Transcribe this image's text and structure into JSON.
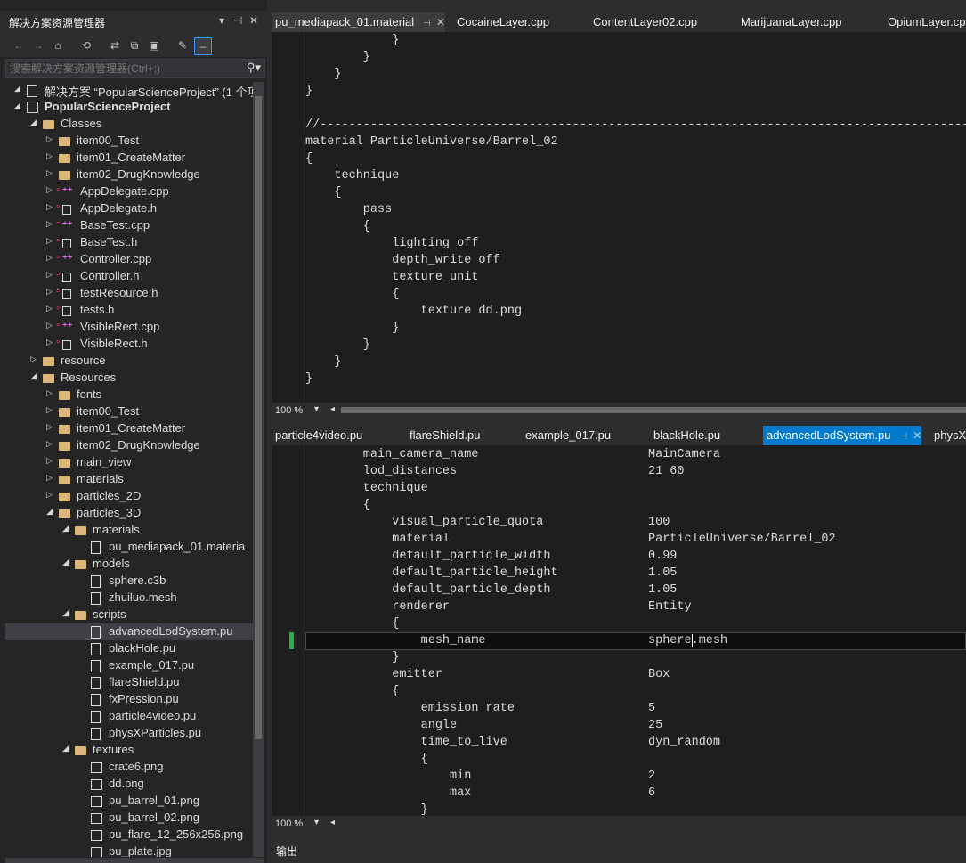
{
  "solution_explorer": {
    "title": "解决方案资源管理器",
    "pin_symbol": "⊿ ꟷ ✕",
    "search_placeholder": "搜索解决方案资源管理器(Ctrl+;)",
    "tree": [
      {
        "label": "解决方案 “PopularScienceProject” (1 个项",
        "depth": 0,
        "icon": "solution-icon",
        "expanded": true
      },
      {
        "label": "PopularScienceProject",
        "depth": 0,
        "icon": "project-icon",
        "expanded": true,
        "bold": true
      },
      {
        "label": "Classes",
        "depth": 1,
        "icon": "folder-icon",
        "expanded": true
      },
      {
        "label": "item00_Test",
        "depth": 2,
        "icon": "folder-icon",
        "expanded": false
      },
      {
        "label": "item01_CreateMatter",
        "depth": 2,
        "icon": "folder-icon",
        "expanded": false
      },
      {
        "label": "item02_DrugKnowledge",
        "depth": 2,
        "icon": "folder-icon",
        "expanded": false
      },
      {
        "label": "AppDelegate.cpp",
        "depth": 2,
        "icon": "cpp-file-icon",
        "expanded": false
      },
      {
        "label": "AppDelegate.h",
        "depth": 2,
        "icon": "header-file-icon",
        "expanded": false
      },
      {
        "label": "BaseTest.cpp",
        "depth": 2,
        "icon": "cpp-file-icon",
        "expanded": false
      },
      {
        "label": "BaseTest.h",
        "depth": 2,
        "icon": "header-file-icon",
        "expanded": false
      },
      {
        "label": "Controller.cpp",
        "depth": 2,
        "icon": "cpp-file-icon",
        "expanded": false
      },
      {
        "label": "Controller.h",
        "depth": 2,
        "icon": "header-file-icon",
        "expanded": false
      },
      {
        "label": "testResource.h",
        "depth": 2,
        "icon": "header-file-icon",
        "expanded": false
      },
      {
        "label": "tests.h",
        "depth": 2,
        "icon": "header-file-icon",
        "expanded": false
      },
      {
        "label": "VisibleRect.cpp",
        "depth": 2,
        "icon": "cpp-file-icon",
        "expanded": false
      },
      {
        "label": "VisibleRect.h",
        "depth": 2,
        "icon": "header-file-icon",
        "expanded": false
      },
      {
        "label": "resource",
        "depth": 1,
        "icon": "folder-icon",
        "expanded": false
      },
      {
        "label": "Resources",
        "depth": 1,
        "icon": "folder-icon",
        "expanded": true
      },
      {
        "label": "fonts",
        "depth": 2,
        "icon": "folder-icon",
        "expanded": false
      },
      {
        "label": "item00_Test",
        "depth": 2,
        "icon": "folder-icon",
        "expanded": false
      },
      {
        "label": "item01_CreateMatter",
        "depth": 2,
        "icon": "folder-icon",
        "expanded": false
      },
      {
        "label": "item02_DrugKnowledge",
        "depth": 2,
        "icon": "folder-icon",
        "expanded": false
      },
      {
        "label": "main_view",
        "depth": 2,
        "icon": "folder-icon",
        "expanded": false
      },
      {
        "label": "materials",
        "depth": 2,
        "icon": "folder-icon",
        "expanded": false
      },
      {
        "label": "particles_2D",
        "depth": 2,
        "icon": "folder-icon",
        "expanded": false
      },
      {
        "label": "particles_3D",
        "depth": 2,
        "icon": "folder-icon",
        "expanded": true
      },
      {
        "label": "materials",
        "depth": 3,
        "icon": "folder-icon",
        "expanded": true
      },
      {
        "label": "pu_mediapack_01.materia",
        "depth": 4,
        "icon": "file-icon",
        "leaf": true
      },
      {
        "label": "models",
        "depth": 3,
        "icon": "folder-icon",
        "expanded": true
      },
      {
        "label": "sphere.c3b",
        "depth": 4,
        "icon": "file-icon",
        "leaf": true
      },
      {
        "label": "zhuiluo.mesh",
        "depth": 4,
        "icon": "file-icon",
        "leaf": true
      },
      {
        "label": "scripts",
        "depth": 3,
        "icon": "folder-icon",
        "expanded": true
      },
      {
        "label": "advancedLodSystem.pu",
        "depth": 4,
        "icon": "file-icon",
        "leaf": true,
        "selected": true
      },
      {
        "label": "blackHole.pu",
        "depth": 4,
        "icon": "file-icon",
        "leaf": true
      },
      {
        "label": "example_017.pu",
        "depth": 4,
        "icon": "file-icon",
        "leaf": true
      },
      {
        "label": "flareShield.pu",
        "depth": 4,
        "icon": "file-icon",
        "leaf": true
      },
      {
        "label": "fxPression.pu",
        "depth": 4,
        "icon": "file-icon",
        "leaf": true
      },
      {
        "label": "particle4video.pu",
        "depth": 4,
        "icon": "file-icon",
        "leaf": true
      },
      {
        "label": "physXParticles.pu",
        "depth": 4,
        "icon": "file-icon",
        "leaf": true
      },
      {
        "label": "textures",
        "depth": 3,
        "icon": "folder-icon",
        "expanded": true
      },
      {
        "label": "crate6.png",
        "depth": 4,
        "icon": "image-file-icon",
        "leaf": true
      },
      {
        "label": "dd.png",
        "depth": 4,
        "icon": "image-file-icon",
        "leaf": true
      },
      {
        "label": "pu_barrel_01.png",
        "depth": 4,
        "icon": "image-file-icon",
        "leaf": true
      },
      {
        "label": "pu_barrel_02.png",
        "depth": 4,
        "icon": "image-file-icon",
        "leaf": true
      },
      {
        "label": "pu_flare_12_256x256.png",
        "depth": 4,
        "icon": "image-file-icon",
        "leaf": true
      },
      {
        "label": "pu_plate.jpg",
        "depth": 4,
        "icon": "image-file-icon",
        "leaf": true
      }
    ]
  },
  "editor_top": {
    "tabs": [
      {
        "label": "pu_mediapack_01.material",
        "active": true
      },
      {
        "label": "CocaineLayer.cpp"
      },
      {
        "label": "ContentLayer02.cpp"
      },
      {
        "label": "MarijuanaLayer.cpp"
      },
      {
        "label": "OpiumLayer.cpp"
      }
    ],
    "lines": [
      "            }",
      "        }",
      "    }",
      "}",
      "",
      "//------------------------------------------------------------------------------------------------------------",
      "material ParticleUniverse/Barrel_02",
      "{",
      "    technique",
      "    {",
      "        pass",
      "        {",
      "            lighting off",
      "            depth_write off",
      "            texture_unit",
      "            {",
      "                texture dd.png",
      "            }",
      "        }",
      "    }",
      "}"
    ],
    "zoom": "100 %"
  },
  "editor_bottom": {
    "tabs": [
      {
        "label": "particle4video.pu"
      },
      {
        "label": "flareShield.pu"
      },
      {
        "label": "example_017.pu"
      },
      {
        "label": "blackHole.pu"
      },
      {
        "label": "advancedLodSystem.pu",
        "active": true
      },
      {
        "label": "physX"
      }
    ],
    "lines": [
      {
        "key": "        main_camera_name",
        "value": "MainCamera"
      },
      {
        "key": "        lod_distances",
        "value": "21 60"
      },
      {
        "key": "        technique",
        "value": ""
      },
      {
        "key": "        {",
        "value": ""
      },
      {
        "key": "            visual_particle_quota",
        "value": "100"
      },
      {
        "key": "            material",
        "value": "ParticleUniverse/Barrel_02"
      },
      {
        "key": "            default_particle_width",
        "value": "0.99"
      },
      {
        "key": "            default_particle_height",
        "value": "1.05"
      },
      {
        "key": "            default_particle_depth",
        "value": "1.05"
      },
      {
        "key": "            renderer",
        "value": "Entity"
      },
      {
        "key": "            {",
        "value": ""
      },
      {
        "key": "                mesh_name",
        "value": "sphere.mesh",
        "current": true
      },
      {
        "key": "            }",
        "value": ""
      },
      {
        "key": "            emitter",
        "value": "Box"
      },
      {
        "key": "            {",
        "value": ""
      },
      {
        "key": "                emission_rate",
        "value": "5"
      },
      {
        "key": "                angle",
        "value": "25"
      },
      {
        "key": "                time_to_live",
        "value": "dyn_random"
      },
      {
        "key": "                {",
        "value": ""
      },
      {
        "key": "                    min",
        "value": "2"
      },
      {
        "key": "                    max",
        "value": "6"
      },
      {
        "key": "                }",
        "value": ""
      }
    ],
    "zoom": "100 %"
  },
  "output_panel": {
    "title": "输出"
  }
}
